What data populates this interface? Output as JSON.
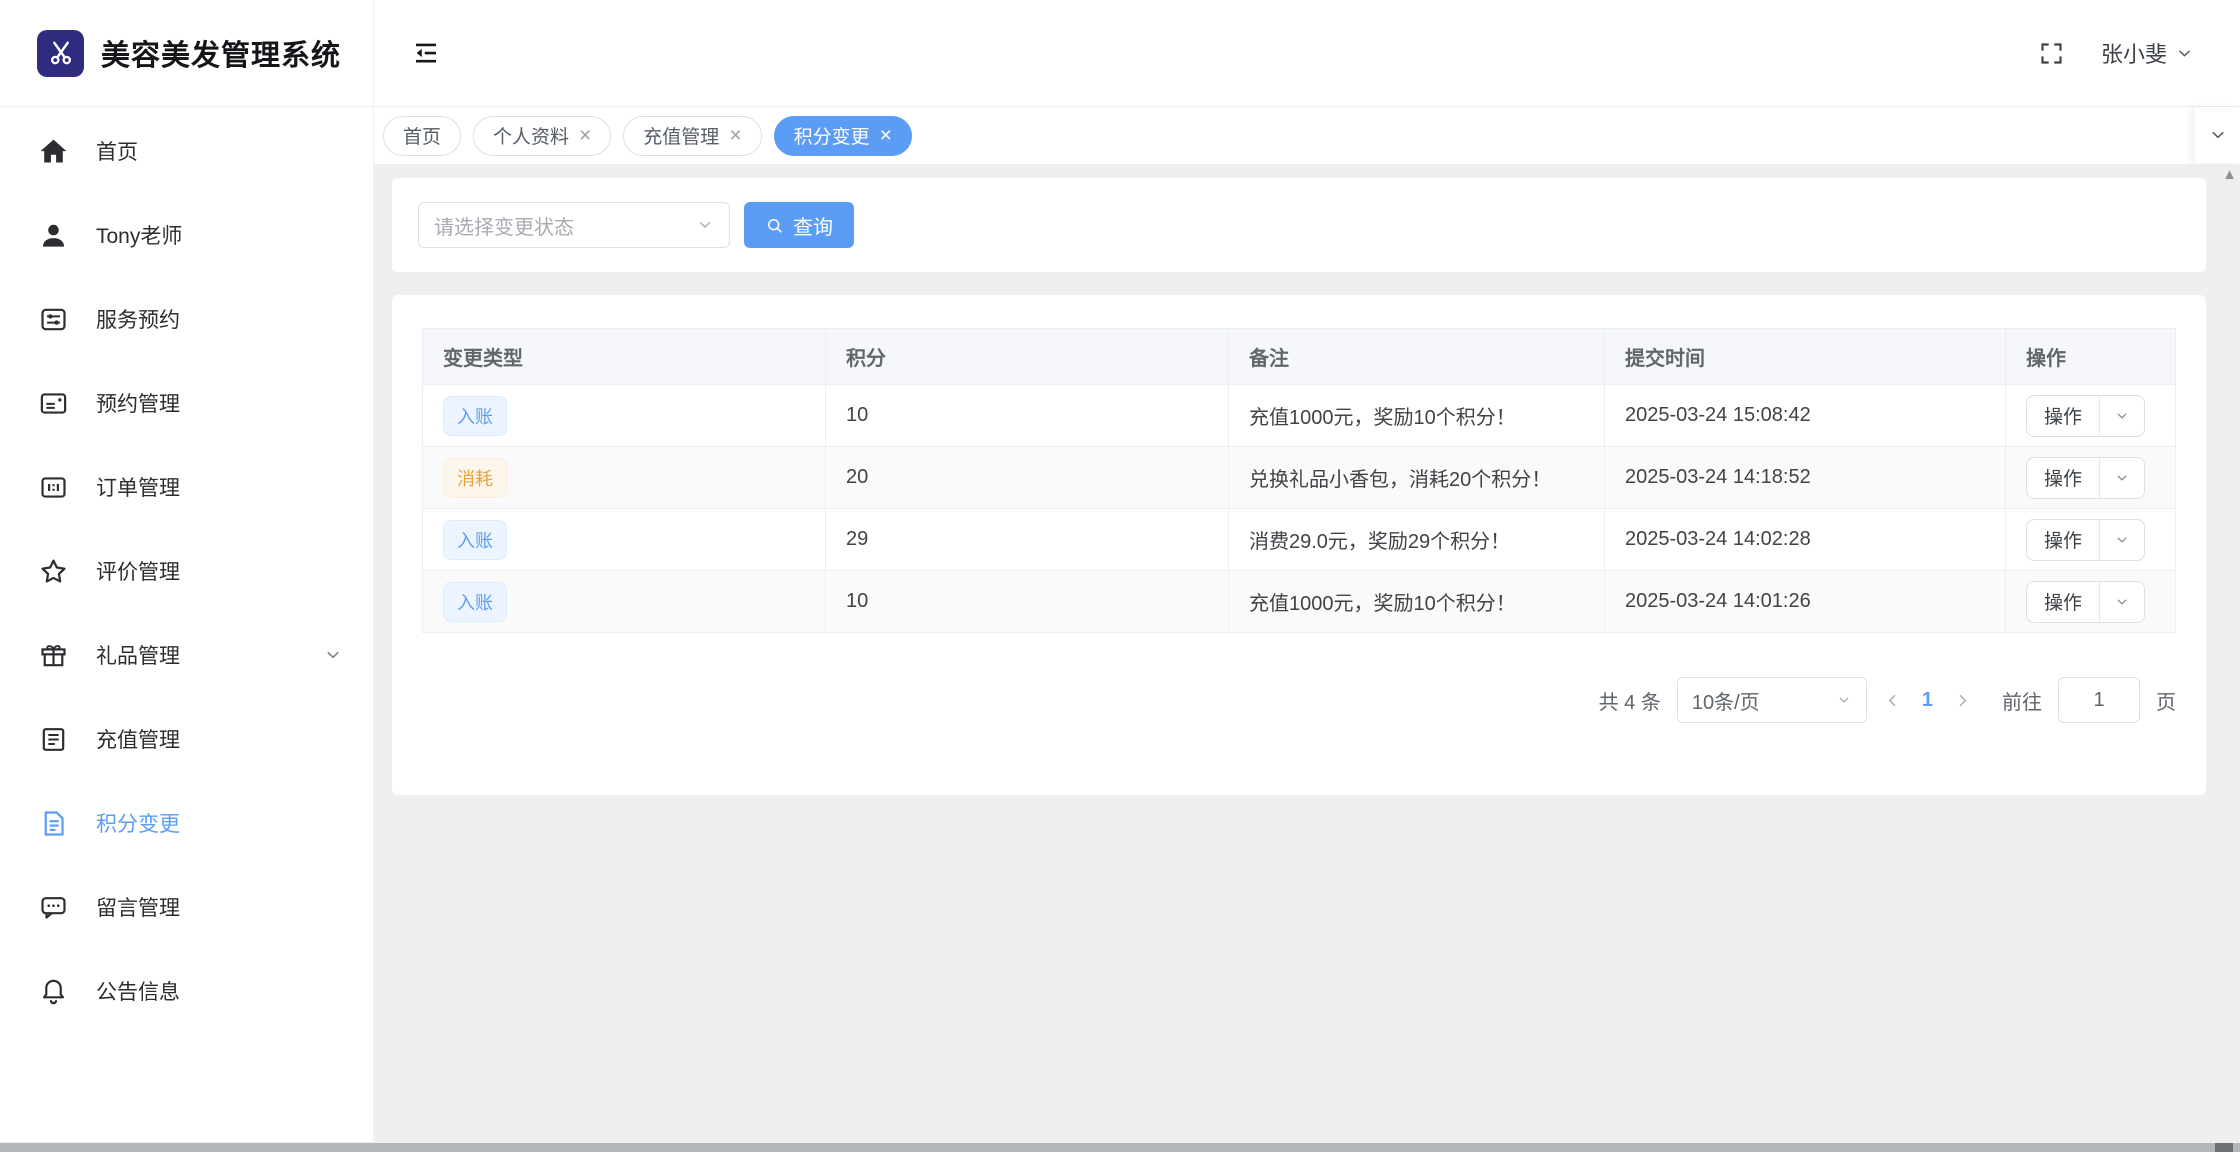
{
  "app": {
    "title": "美容美发管理系统",
    "user": "张小斐"
  },
  "sidebar": {
    "items": [
      {
        "label": "首页",
        "icon": "home-icon"
      },
      {
        "label": "Tony老师",
        "icon": "user-icon"
      },
      {
        "label": "服务预约",
        "icon": "service-icon"
      },
      {
        "label": "预约管理",
        "icon": "booking-icon"
      },
      {
        "label": "订单管理",
        "icon": "order-icon"
      },
      {
        "label": "评价管理",
        "icon": "star-icon"
      },
      {
        "label": "礼品管理",
        "icon": "gift-icon",
        "expandable": true
      },
      {
        "label": "充值管理",
        "icon": "recharge-icon"
      },
      {
        "label": "积分变更",
        "icon": "points-icon",
        "active": true
      },
      {
        "label": "留言管理",
        "icon": "message-icon"
      },
      {
        "label": "公告信息",
        "icon": "bell-icon"
      }
    ]
  },
  "tabs": [
    {
      "label": "首页"
    },
    {
      "label": "个人资料",
      "closable": true
    },
    {
      "label": "充值管理",
      "closable": true
    },
    {
      "label": "积分变更",
      "closable": true,
      "active": true
    }
  ],
  "filter": {
    "select_placeholder": "请选择变更状态",
    "search_label": "查询"
  },
  "table": {
    "headers": [
      "变更类型",
      "积分",
      "备注",
      "提交时间",
      "操作"
    ],
    "rows": [
      {
        "type": "入账",
        "type_style": "blue",
        "points": "10",
        "remark": "充值1000元，奖励10个积分！",
        "time": "2025-03-24 15:08:42",
        "action": "操作"
      },
      {
        "type": "消耗",
        "type_style": "orange",
        "points": "20",
        "remark": "兑换礼品小香包，消耗20个积分！",
        "time": "2025-03-24 14:18:52",
        "action": "操作"
      },
      {
        "type": "入账",
        "type_style": "blue",
        "points": "29",
        "remark": "消费29.0元，奖励29个积分！",
        "time": "2025-03-24 14:02:28",
        "action": "操作"
      },
      {
        "type": "入账",
        "type_style": "blue",
        "points": "10",
        "remark": "充值1000元，奖励10个积分！",
        "time": "2025-03-24 14:01:26",
        "action": "操作"
      }
    ]
  },
  "pagination": {
    "total": "共 4 条",
    "page_size": "10条/页",
    "current_page": "1",
    "goto_label": "前往",
    "goto_value": "1",
    "page_label": "页"
  },
  "colors": {
    "accent_blue": "#5b9cf5",
    "brand_indigo": "#2f2c80",
    "tag_blue_bg": "#ecf5ff",
    "tag_orange_bg": "#fdf6ec",
    "tag_orange_text": "#e6a23c",
    "table_header_bg": "#f5f7fa",
    "page_bg": "#efefef"
  }
}
